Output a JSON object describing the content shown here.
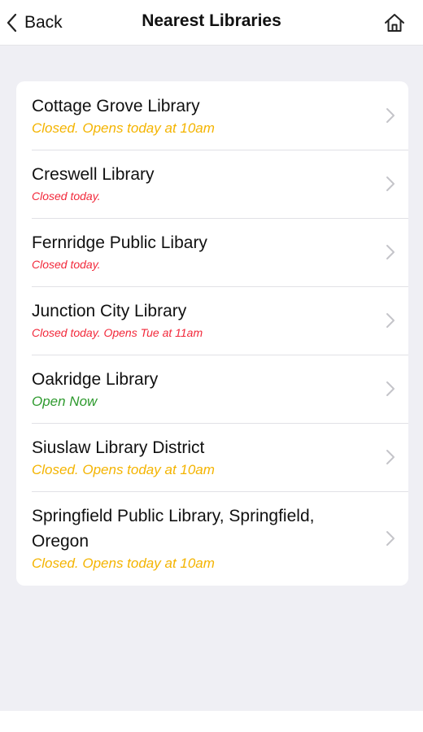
{
  "nav": {
    "back_label": "Back",
    "title": "Nearest Libraries",
    "home_icon": "home-icon"
  },
  "colors": {
    "closed_opens": "#f4b400",
    "closed_today": "#f2283a",
    "open_now": "#2e9a2e"
  },
  "libraries": [
    {
      "name": "Cottage Grove Library",
      "status": "Closed. Opens today at 10am",
      "status_type": "closed_opens"
    },
    {
      "name": "Creswell Library",
      "status": "Closed today.",
      "status_type": "closed_today"
    },
    {
      "name": "Fernridge Public Libary",
      "status": "Closed today.",
      "status_type": "closed_today"
    },
    {
      "name": "Junction City Library",
      "status": "Closed today. Opens Tue at 11am",
      "status_type": "closed_today"
    },
    {
      "name": "Oakridge Library",
      "status": "Open Now",
      "status_type": "open_now"
    },
    {
      "name": "Siuslaw Library District",
      "status": "Closed. Opens today at 10am",
      "status_type": "closed_opens"
    },
    {
      "name": "Springfield Public Library, Springfield, Oregon",
      "status": "Closed. Opens today at 10am",
      "status_type": "closed_opens"
    }
  ]
}
